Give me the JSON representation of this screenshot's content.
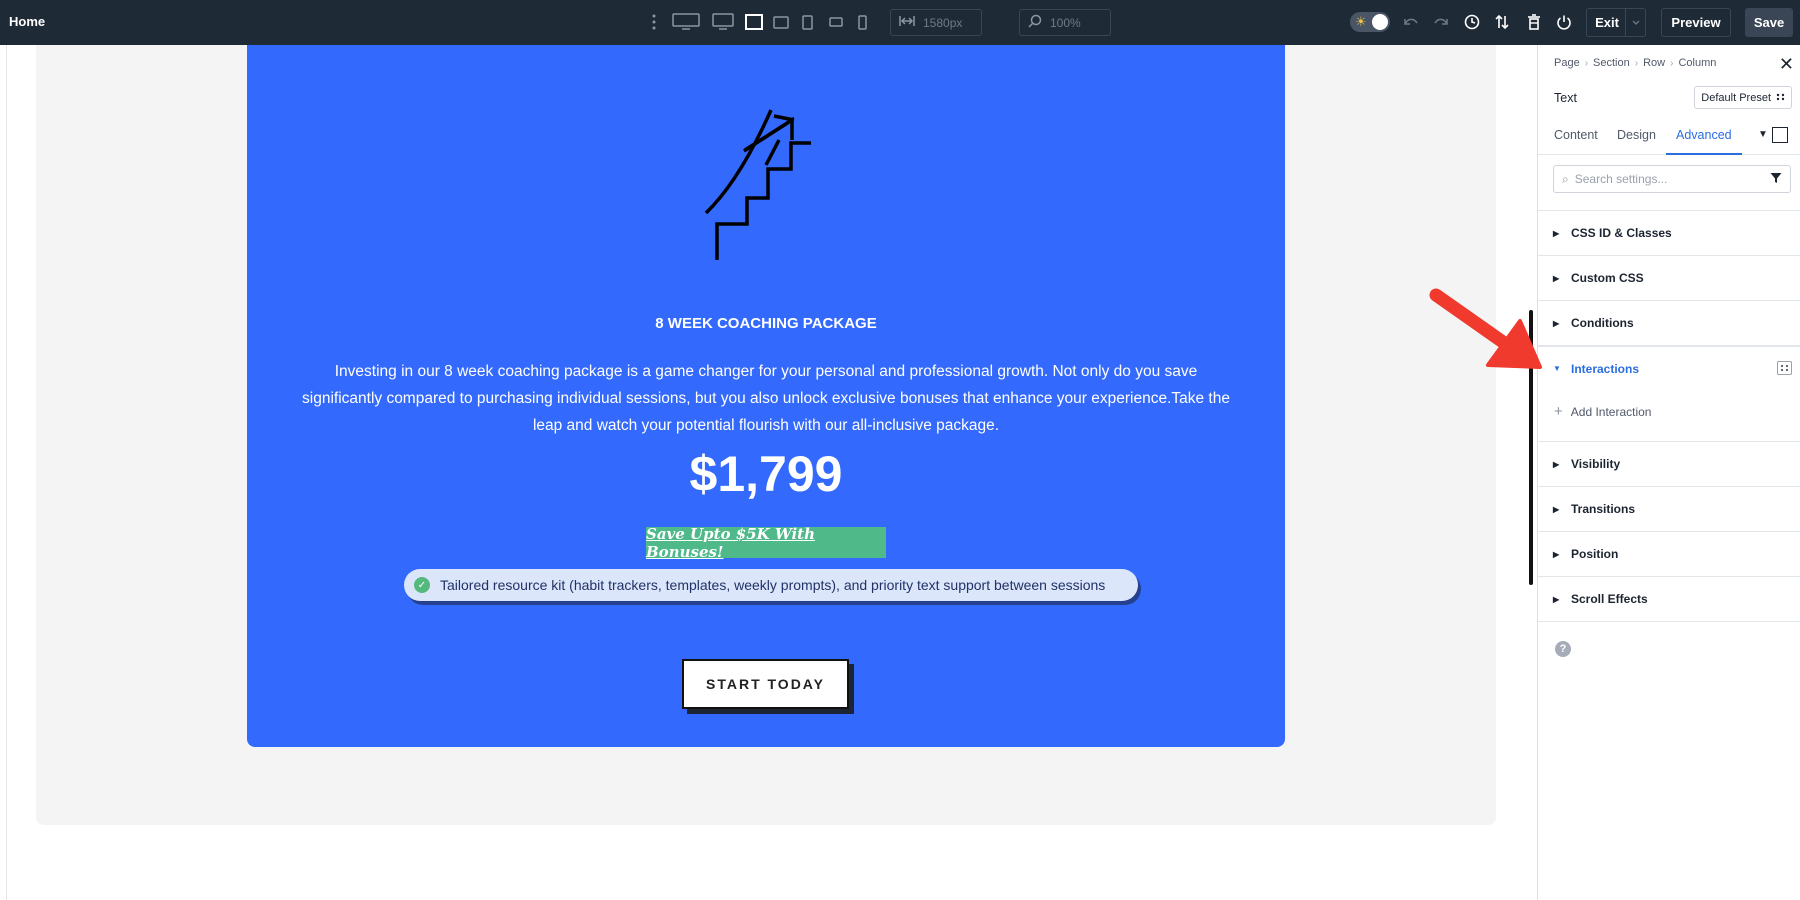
{
  "topbar": {
    "title": "Home",
    "width_value": "1580px",
    "zoom_value": "100%",
    "exit_label": "Exit",
    "preview_label": "Preview",
    "save_label": "Save",
    "icons": [
      "kebab-icon",
      "desktop-wide-icon",
      "desktop-icon",
      "laptop-icon",
      "tablet-landscape-icon",
      "tablet-icon",
      "phone-landscape-icon",
      "phone-icon",
      "width-icon",
      "zoom-icon",
      "theme-toggle",
      "undo-icon",
      "redo-icon",
      "history-icon",
      "sort-icon",
      "trash-icon",
      "power-icon",
      "chevron-down-icon"
    ]
  },
  "card": {
    "title": "8 WEEK COACHING PACKAGE",
    "description": "Investing in our 8 week coaching package is a game changer for your personal and professional growth. Not only do you save significantly compared to purchasing individual sessions, but you also unlock exclusive bonuses that enhance your experience.Take the leap and watch your potential flourish with our all-inclusive package.",
    "price": "$1,799",
    "badge": "Save Upto $5K With Bonuses!",
    "feature": "Tailored resource kit (habit trackers, templates, weekly prompts), and priority text support between sessions",
    "cta_label": "START TODAY",
    "colors": {
      "card": "#3369fc",
      "badge": "#4fb98a",
      "pill": "#dbe6fb"
    }
  },
  "panel": {
    "breadcrumb": [
      "Page",
      "Section",
      "Row",
      "Column"
    ],
    "module_name": "Text",
    "preset_label": "Default Preset",
    "tabs": [
      {
        "label": "Content",
        "active": false
      },
      {
        "label": "Design",
        "active": false
      },
      {
        "label": "Advanced",
        "active": true
      }
    ],
    "search_placeholder": "Search settings...",
    "groups": [
      {
        "label": "CSS ID & Classes",
        "open": false
      },
      {
        "label": "Custom CSS",
        "open": false
      },
      {
        "label": "Conditions",
        "open": false
      },
      {
        "label": "Interactions",
        "open": true
      },
      {
        "label": "Visibility",
        "open": false
      },
      {
        "label": "Transitions",
        "open": false
      },
      {
        "label": "Position",
        "open": false
      },
      {
        "label": "Scroll Effects",
        "open": false
      }
    ],
    "add_interaction_label": "Add Interaction",
    "accent_color": "#2b6de0"
  }
}
